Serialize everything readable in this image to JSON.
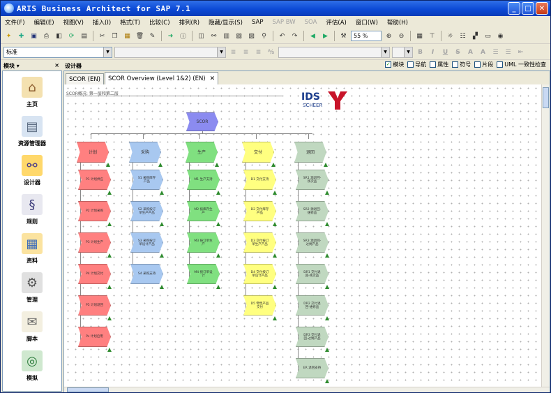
{
  "window": {
    "title": "ARIS Business Architect for SAP 7.1"
  },
  "menu": [
    "文件(F)",
    "编辑(E)",
    "视图(V)",
    "插入(I)",
    "格式(T)",
    "比较(C)",
    "排列(R)",
    "隐藏/显示(S)",
    "SAP",
    "SAP BW",
    "SOA",
    "评估(A)",
    "窗口(W)",
    "帮助(H)"
  ],
  "menu_disabled": [
    "SAP BW",
    "SOA"
  ],
  "toolbar": {
    "zoom": "55 %",
    "style": "标准"
  },
  "modules_panel": {
    "title": "模块 ▾",
    "close": "×"
  },
  "designer_panel": {
    "title": "设计器"
  },
  "checkboxes": [
    {
      "label": "模块",
      "checked": true
    },
    {
      "label": "导航",
      "checked": false
    },
    {
      "label": "属性",
      "checked": false
    },
    {
      "label": "符号",
      "checked": false
    },
    {
      "label": "片段",
      "checked": false
    },
    {
      "label": "UML 一致性检查",
      "checked": false
    }
  ],
  "sidebar": [
    {
      "label": "主页",
      "icon": "home-icon"
    },
    {
      "label": "资源管理器",
      "icon": "explorer-icon"
    },
    {
      "label": "设计器",
      "icon": "designer-icon"
    },
    {
      "label": "规则",
      "icon": "rules-icon"
    },
    {
      "label": "资料",
      "icon": "data-icon"
    },
    {
      "label": "管理",
      "icon": "admin-icon"
    },
    {
      "label": "脚本",
      "icon": "script-icon"
    },
    {
      "label": "模拟",
      "icon": "simulation-icon"
    }
  ],
  "tabs": [
    {
      "label": "SCOR (EN)",
      "active": false
    },
    {
      "label": "SCOR Overview (Level 1&2) (EN)",
      "active": true
    }
  ],
  "canvas": {
    "caption": "SCOR概况: 第一层和第二层",
    "logo_text": "IDS",
    "logo_sub": "SCHEER",
    "root": "SCOR",
    "columns": [
      {
        "name": "计划",
        "color": "#ff8080",
        "items": [
          "P1 计划供应",
          "P2 计划采购",
          "P3 计划生产",
          "P4 计划交付",
          "P5 计划退回",
          "Ps 计划启用"
        ]
      },
      {
        "name": "采购",
        "color": "#a8c8f0",
        "items": [
          "S1 采购库存产品",
          "S2 采购按订单生产产品",
          "S3 采购按订单设计产品",
          "S4 采购支持"
        ]
      },
      {
        "name": "生产",
        "color": "#80e080",
        "items": [
          "M1 生产支持",
          "M2 按库存生产",
          "M3 按订单生产",
          "M4 按订单设计"
        ]
      },
      {
        "name": "交付",
        "color": "#ffff80",
        "items": [
          "D1 交付支持",
          "D2 交付库存产品",
          "D3 交付按订单生产产品",
          "D4 交付按订单设计产品",
          "D5 零售产品交付"
        ]
      },
      {
        "name": "退回",
        "color": "#c0d8c0",
        "items": [
          "SR1 源退回-残次品",
          "SR2 源退回-维修品",
          "SR3 源退回-过剩产品",
          "DR1 交付退回-残次品",
          "DR2 交付退回-维修品",
          "DR3 交付退回-过剩产品",
          "ER 退回支持"
        ]
      }
    ]
  }
}
